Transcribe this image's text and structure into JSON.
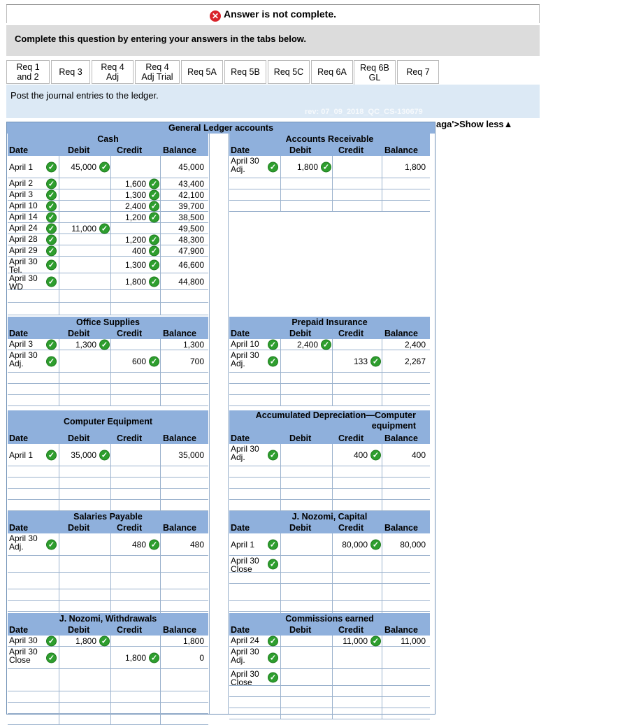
{
  "banner": {
    "text": "Answer is not complete."
  },
  "instruction": "Complete this question by entering your answers in the tabs below.",
  "tabs": [
    {
      "line1": "Req 1",
      "line2": "and 2"
    },
    {
      "line1": "Req 3",
      "line2": ""
    },
    {
      "line1": "Req 4",
      "line2": "Adj"
    },
    {
      "line1": "Req 4",
      "line2": "Adj Trial"
    },
    {
      "line1": "Req 5A",
      "line2": ""
    },
    {
      "line1": "Req 5B",
      "line2": ""
    },
    {
      "line1": "Req 5C",
      "line2": ""
    },
    {
      "line1": "Req 6A",
      "line2": ""
    },
    {
      "line1": "Req 6B",
      "line2": "GL"
    },
    {
      "line1": "Req 7",
      "line2": ""
    }
  ],
  "active_tab": "Req 6B GL",
  "post_instruction": "Post the journal entries to the ledger.",
  "rev_text": "rev: 07_09_2018_QC_CS-130679",
  "show_less": "aga'>Show less▲",
  "ledger_title": "General Ledger accounts",
  "col_headers": {
    "date": "Date",
    "debit": "Debit",
    "credit": "Credit",
    "balance": "Balance"
  },
  "accounts": {
    "cash": {
      "name": "Cash",
      "rows": [
        {
          "date": "April 1",
          "debit": "45,000",
          "credit": "",
          "balance": "45,000"
        },
        {
          "date": "April 2",
          "debit": "",
          "credit": "1,600",
          "balance": "43,400"
        },
        {
          "date": "April 3",
          "debit": "",
          "credit": "1,300",
          "balance": "42,100"
        },
        {
          "date": "April 10",
          "debit": "",
          "credit": "2,400",
          "balance": "39,700"
        },
        {
          "date": "April 14",
          "debit": "",
          "credit": "1,200",
          "balance": "38,500"
        },
        {
          "date": "April 24",
          "debit": "11,000",
          "credit": "",
          "balance": "49,500"
        },
        {
          "date": "April 28",
          "debit": "",
          "credit": "1,200",
          "balance": "48,300"
        },
        {
          "date": "April 29",
          "debit": "",
          "credit": "400",
          "balance": "47,900"
        },
        {
          "date": "April 30",
          "date2": "Tel.",
          "debit": "",
          "credit": "1,300",
          "balance": "46,600"
        },
        {
          "date": "April 30",
          "date2": "WD",
          "debit": "",
          "credit": "1,800",
          "balance": "44,800"
        }
      ]
    },
    "accounts_receivable": {
      "name": "Accounts Receivable",
      "rows": [
        {
          "date": "April 30",
          "date2": "Adj.",
          "debit": "1,800",
          "credit": "",
          "balance": "1,800"
        }
      ]
    },
    "office_supplies": {
      "name": "Office Supplies",
      "rows": [
        {
          "date": "April 3",
          "debit": "1,300",
          "credit": "",
          "balance": "1,300"
        },
        {
          "date": "April 30",
          "date2": "Adj.",
          "debit": "",
          "credit": "600",
          "balance": "700"
        }
      ]
    },
    "prepaid_insurance": {
      "name": "Prepaid Insurance",
      "rows": [
        {
          "date": "April 10",
          "debit": "2,400",
          "credit": "",
          "balance": "2,400"
        },
        {
          "date": "April 30",
          "date2": "Adj.",
          "debit": "",
          "credit": "133",
          "balance": "2,267"
        }
      ]
    },
    "computer_equipment": {
      "name": "Computer Equipment",
      "rows": [
        {
          "date": "April 1",
          "debit": "35,000",
          "credit": "",
          "balance": "35,000"
        }
      ]
    },
    "accum_dep": {
      "name_line1": "Accumulated Depreciation—Computer",
      "name_line2": "equipment",
      "rows": [
        {
          "date": "April 30",
          "date2": "Adj.",
          "debit": "",
          "credit": "400",
          "balance": "400"
        }
      ]
    },
    "salaries_payable": {
      "name": "Salaries Payable",
      "rows": [
        {
          "date": "April 30",
          "date2": "Adj.",
          "debit": "",
          "credit": "480",
          "balance": "480"
        }
      ]
    },
    "capital": {
      "name": "J. Nozomi, Capital",
      "rows": [
        {
          "date": "April 1",
          "debit": "",
          "credit": "80,000",
          "balance": "80,000"
        },
        {
          "date": "April 30",
          "date2": "Close",
          "debit": "",
          "credit": "",
          "balance": ""
        }
      ]
    },
    "withdrawals": {
      "name": "J. Nozomi, Withdrawals",
      "rows": [
        {
          "date": "April 30",
          "debit": "1,800",
          "credit": "",
          "balance": "1,800"
        },
        {
          "date": "April 30",
          "date2": "Close",
          "debit": "",
          "credit": "1,800",
          "balance": "0"
        }
      ]
    },
    "commissions": {
      "name": "Commissions earned",
      "rows": [
        {
          "date": "April 24",
          "debit": "",
          "credit": "11,000",
          "balance": "11,000"
        },
        {
          "date": "April 30",
          "date2": "Adj.",
          "debit": "",
          "credit": "",
          "balance": ""
        },
        {
          "date": "April 30",
          "date2": "Close",
          "debit": "",
          "credit": "",
          "balance": ""
        }
      ]
    }
  },
  "colors": {
    "header_blue": "#8fb0dc",
    "post_bar": "#dce9f5",
    "check_green": "#2e9e2e",
    "error_red": "#d9242b"
  },
  "icons": {
    "error": "x-circle-icon",
    "correct": "check-circle-icon"
  }
}
